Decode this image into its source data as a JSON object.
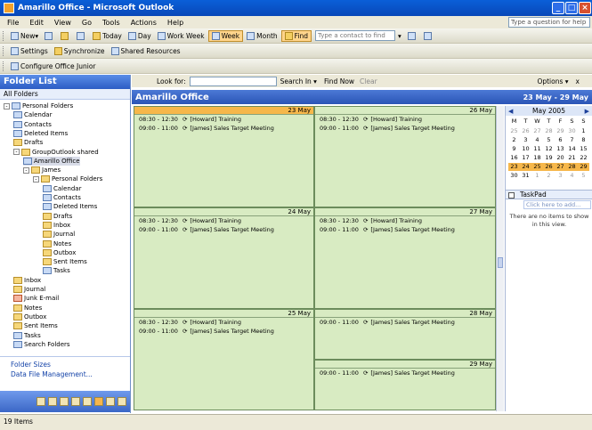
{
  "window": {
    "title": "Amarillo Office - Microsoft Outlook"
  },
  "menu": [
    "File",
    "Edit",
    "View",
    "Go",
    "Tools",
    "Actions",
    "Help"
  ],
  "help_box": "Type a question for help",
  "toolbar1": {
    "new": "New",
    "today": "Today",
    "day": "Day",
    "work_week": "Work Week",
    "week": "Week",
    "month": "Month",
    "find": "Find",
    "address_search": "Type a contact to find"
  },
  "toolbar2": {
    "settings": "Settings",
    "synchronize": "Synchronize",
    "shared": "Shared Resources"
  },
  "toolbar3": {
    "configure": "Configure Office Junior"
  },
  "folder_pane": {
    "title": "Folder List",
    "sub": "All Folders",
    "tree": [
      {
        "label": "Personal Folders",
        "level": 0,
        "icon": "personal",
        "exp": "-"
      },
      {
        "label": "Calendar",
        "level": 1,
        "icon": "calendar"
      },
      {
        "label": "Contacts",
        "level": 1,
        "icon": "contacts"
      },
      {
        "label": "Deleted Items",
        "level": 1,
        "icon": "deleted"
      },
      {
        "label": "Drafts",
        "level": 1,
        "icon": "drafts"
      },
      {
        "label": "GroupOutlook shared",
        "level": 1,
        "icon": "folder",
        "exp": "-"
      },
      {
        "label": "Amarillo Office",
        "level": 2,
        "icon": "calendar",
        "selected": true
      },
      {
        "label": "James",
        "level": 2,
        "icon": "folder",
        "exp": "-"
      },
      {
        "label": "Personal Folders",
        "level": 3,
        "icon": "folder",
        "exp": "-"
      },
      {
        "label": "Calendar",
        "level": 4,
        "icon": "calendar"
      },
      {
        "label": "Contacts",
        "level": 4,
        "icon": "contacts"
      },
      {
        "label": "Deleted Items",
        "level": 4,
        "icon": "deleted"
      },
      {
        "label": "Drafts",
        "level": 4,
        "icon": "drafts"
      },
      {
        "label": "Inbox",
        "level": 4,
        "icon": "inbox"
      },
      {
        "label": "Journal",
        "level": 4,
        "icon": "journal"
      },
      {
        "label": "Notes",
        "level": 4,
        "icon": "notes"
      },
      {
        "label": "Outbox",
        "level": 4,
        "icon": "outbox"
      },
      {
        "label": "Sent Items",
        "level": 4,
        "icon": "sent"
      },
      {
        "label": "Tasks",
        "level": 4,
        "icon": "tasks"
      },
      {
        "label": "Inbox",
        "level": 1,
        "icon": "inbox"
      },
      {
        "label": "Journal",
        "level": 1,
        "icon": "journal"
      },
      {
        "label": "Junk E-mail",
        "level": 1,
        "icon": "junk"
      },
      {
        "label": "Notes",
        "level": 1,
        "icon": "notes"
      },
      {
        "label": "Outbox",
        "level": 1,
        "icon": "outbox"
      },
      {
        "label": "Sent Items",
        "level": 1,
        "icon": "sent"
      },
      {
        "label": "Tasks",
        "level": 1,
        "icon": "tasks"
      },
      {
        "label": "Search Folders",
        "level": 1,
        "icon": "search"
      }
    ],
    "links": [
      "Folder Sizes",
      "Data File Management..."
    ]
  },
  "find_bar": {
    "look_for": "Look for:",
    "search_in": "Search In",
    "find_now": "Find Now",
    "clear": "Clear",
    "options": "Options",
    "close": "x"
  },
  "calendar": {
    "title": "Amarillo Office",
    "range": "23 May - 29 May",
    "days": [
      {
        "date": "23 May",
        "today": true,
        "col": 0,
        "row": 0,
        "appts": [
          {
            "time": "08:30 - 12:30",
            "subject": "[Howard] Training"
          },
          {
            "time": "09:00 - 11:00",
            "subject": "[James] Sales Target Meeting"
          }
        ]
      },
      {
        "date": "26 May",
        "today": false,
        "col": 1,
        "row": 0,
        "appts": [
          {
            "time": "08:30 - 12:30",
            "subject": "[Howard] Training"
          },
          {
            "time": "09:00 - 11:00",
            "subject": "[James] Sales Target Meeting"
          }
        ]
      },
      {
        "date": "24 May",
        "today": false,
        "col": 0,
        "row": 1,
        "appts": [
          {
            "time": "08:30 - 12:30",
            "subject": "[Howard] Training"
          },
          {
            "time": "09:00 - 11:00",
            "subject": "[James] Sales Target Meeting"
          }
        ]
      },
      {
        "date": "27 May",
        "today": false,
        "col": 1,
        "row": 1,
        "appts": [
          {
            "time": "08:30 - 12:30",
            "subject": "[Howard] Training"
          },
          {
            "time": "09:00 - 11:00",
            "subject": "[James] Sales Target Meeting"
          }
        ]
      },
      {
        "date": "25 May",
        "today": false,
        "col": 0,
        "row": 2,
        "appts": [
          {
            "time": "08:30 - 12:30",
            "subject": "[Howard] Training"
          },
          {
            "time": "09:00 - 11:00",
            "subject": "[James] Sales Target Meeting"
          }
        ]
      },
      {
        "date": "28 May",
        "today": false,
        "col": 1,
        "row": 2,
        "appts": [
          {
            "time": "09:00 - 11:00",
            "subject": "[James] Sales Target Meeting"
          }
        ]
      },
      {
        "date": "29 May",
        "today": false,
        "col": 1,
        "row": 3,
        "appts": [
          {
            "time": "09:00 - 11:00",
            "subject": "[James] Sales Target Meeting"
          }
        ]
      }
    ]
  },
  "mini_calendar": {
    "month": "May 2005",
    "weekday_headers": [
      "M",
      "T",
      "W",
      "T",
      "F",
      "S",
      "S"
    ],
    "weeks": [
      [
        "25",
        "26",
        "27",
        "28",
        "29",
        "30",
        "1"
      ],
      [
        "2",
        "3",
        "4",
        "5",
        "6",
        "7",
        "8"
      ],
      [
        "9",
        "10",
        "11",
        "12",
        "13",
        "14",
        "15"
      ],
      [
        "16",
        "17",
        "18",
        "19",
        "20",
        "21",
        "22"
      ],
      [
        "23",
        "24",
        "25",
        "26",
        "27",
        "28",
        "29"
      ],
      [
        "30",
        "31",
        "1",
        "2",
        "3",
        "4",
        "5"
      ]
    ]
  },
  "taskpad": {
    "header": "TaskPad",
    "new_task": "Click here to add...",
    "empty": "There are no items to show in this view."
  },
  "status": "19 Items"
}
